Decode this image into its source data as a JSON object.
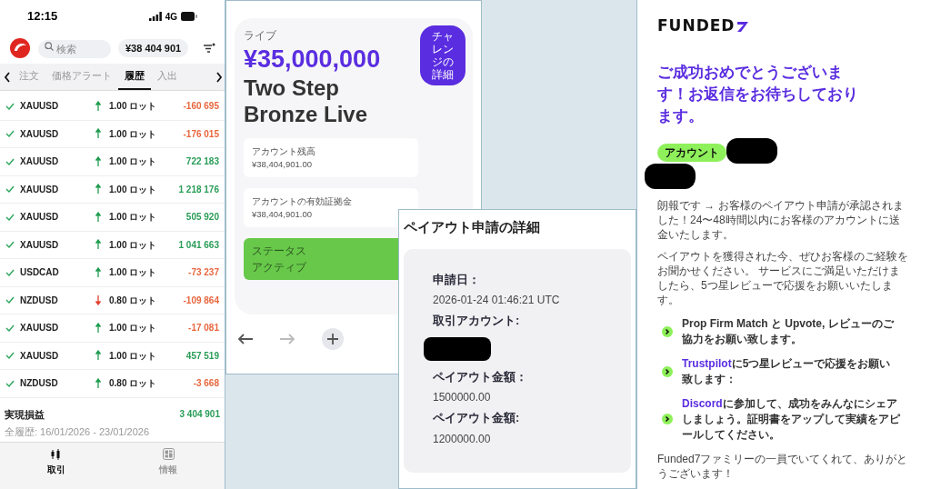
{
  "trading_app": {
    "status_bar": {
      "time": "12:15",
      "network": "4G"
    },
    "search": {
      "placeholder": "検索"
    },
    "balance": "¥38 404 901",
    "tabs": [
      {
        "label": "注文",
        "selected": false
      },
      {
        "label": "価格アラート",
        "selected": false
      },
      {
        "label": "履歴",
        "selected": true
      },
      {
        "label": "入出",
        "selected": false
      }
    ],
    "rows": [
      {
        "symbol": "XAUUSD",
        "rising": true,
        "lots": "1.00 ロット",
        "pnl": "-160 695",
        "profit": false
      },
      {
        "symbol": "XAUUSD",
        "rising": true,
        "lots": "1.00 ロット",
        "pnl": "-176 015",
        "profit": false
      },
      {
        "symbol": "XAUUSD",
        "rising": true,
        "lots": "1.00 ロット",
        "pnl": "722 183",
        "profit": true
      },
      {
        "symbol": "XAUUSD",
        "rising": true,
        "lots": "1.00 ロット",
        "pnl": "1 218 176",
        "profit": true
      },
      {
        "symbol": "XAUUSD",
        "rising": true,
        "lots": "1.00 ロット",
        "pnl": "505 920",
        "profit": true
      },
      {
        "symbol": "XAUUSD",
        "rising": true,
        "lots": "1.00 ロット",
        "pnl": "1 041 663",
        "profit": true
      },
      {
        "symbol": "USDCAD",
        "rising": true,
        "lots": "1.00 ロット",
        "pnl": "-73 237",
        "profit": false
      },
      {
        "symbol": "NZDUSD",
        "rising": false,
        "lots": "0.80 ロット",
        "pnl": "-109 864",
        "profit": false
      },
      {
        "symbol": "XAUUSD",
        "rising": true,
        "lots": "1.00 ロット",
        "pnl": "-17 081",
        "profit": false
      },
      {
        "symbol": "XAUUSD",
        "rising": true,
        "lots": "1.00 ロット",
        "pnl": "457 519",
        "profit": true
      },
      {
        "symbol": "NZDUSD",
        "rising": true,
        "lots": "0.80 ロット",
        "pnl": "-3 668",
        "profit": false
      }
    ],
    "summary": {
      "label": "実現損益",
      "value": "3 404 901",
      "range": "全履歴: 16/01/2026 - 23/01/2026"
    },
    "bottom_nav": [
      {
        "label": "取引",
        "kind": "trade",
        "selected": true
      },
      {
        "label": "情報",
        "kind": "info",
        "selected": false
      }
    ]
  },
  "account_card": {
    "type_label": "ライブ",
    "amount": "¥35,000,000",
    "title": "Two Step Bronze Live",
    "details_button": "チャレンジの詳細",
    "fields": [
      {
        "label": "アカウント残高",
        "value": "¥38,404,901.00"
      },
      {
        "label": "アカウントの有効証拠金",
        "value": "¥38,404,901.00"
      }
    ],
    "status": {
      "label": "ステータス",
      "value": "アクティブ"
    }
  },
  "payout_details": {
    "title": "ペイアウト申請の詳細",
    "items": [
      {
        "label": "申請日：",
        "value": "2026-01-24 01:46:21 UTC"
      },
      {
        "label": "取引アカウント:",
        "redacted": true
      },
      {
        "label": "ペイアウト金額：",
        "value": "1500000.00"
      },
      {
        "label": "ペイアウト金額:",
        "value": "1200000.00"
      }
    ]
  },
  "email": {
    "brand": "FUNDED",
    "heading": "ご成功おめでとうございます！お返信をお待ちしております。",
    "account_tag": "アカウント",
    "paragraphs": [
      "朗報です → お客様のペイアウト申請が承認されました！24〜48時間以内にお客様のアカウントに送金いたします。",
      "ペイアウトを獲得された今、ぜひお客様のご経験をお聞かせください。 サービスにご満足いただけましたら、5つ星レビューで応援をお願いいたします。"
    ],
    "bullets": [
      {
        "text": "Prop Firm Match と Upvote, レビューのご協力をお願い致します。"
      },
      {
        "link": "Trustpilot",
        "text": "に5つ星レビューで応援をお願い致します："
      },
      {
        "link": "Discord",
        "text": "に参加して、成功をみんなにシェアしましょう。証明書をアップして実績をアピールしてください。"
      }
    ],
    "closing": "Funded7ファミリーの一員でいてくれて、ありがとうございます！"
  }
}
